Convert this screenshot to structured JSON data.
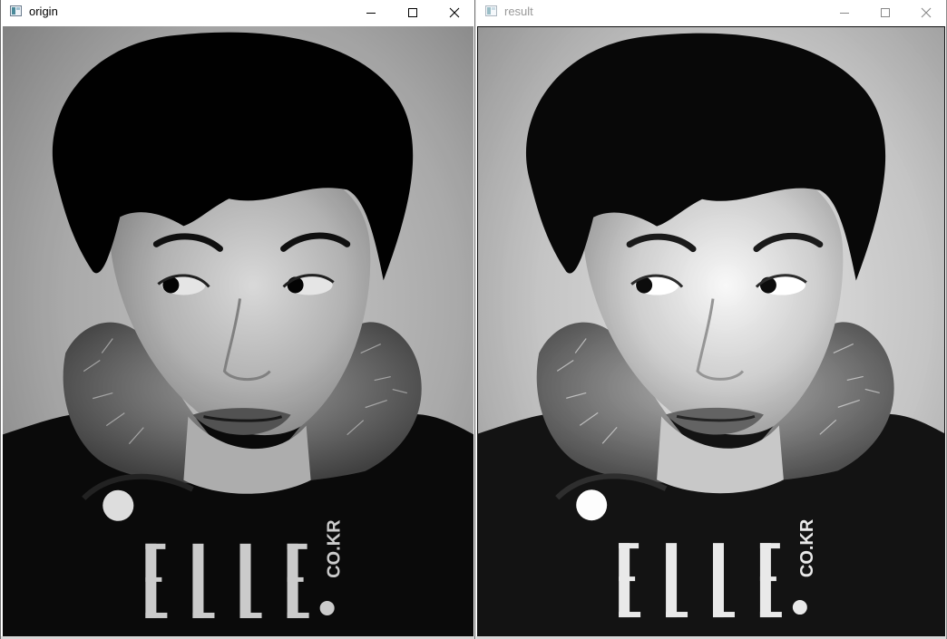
{
  "windows": [
    {
      "title": "origin",
      "active": true,
      "controls": {
        "minimize": "minimize-icon",
        "maximize": "maximize-icon",
        "close": "close-icon"
      },
      "image": {
        "description_tags": [
          "grayscale-portrait"
        ],
        "watermark": {
          "brand": "ELLE",
          "suffix": ".CO.KR"
        }
      }
    },
    {
      "title": "result",
      "active": false,
      "controls": {
        "minimize": "minimize-icon",
        "maximize": "maximize-icon",
        "close": "close-icon"
      },
      "image": {
        "description_tags": [
          "grayscale-portrait-enhanced"
        ],
        "watermark": {
          "brand": "ELLE",
          "suffix": ".CO.KR"
        }
      }
    }
  ],
  "colors": {
    "titlebar_active_text": "#000000",
    "titlebar_inactive_text": "#999999",
    "image_background": "#0b0b0b"
  }
}
